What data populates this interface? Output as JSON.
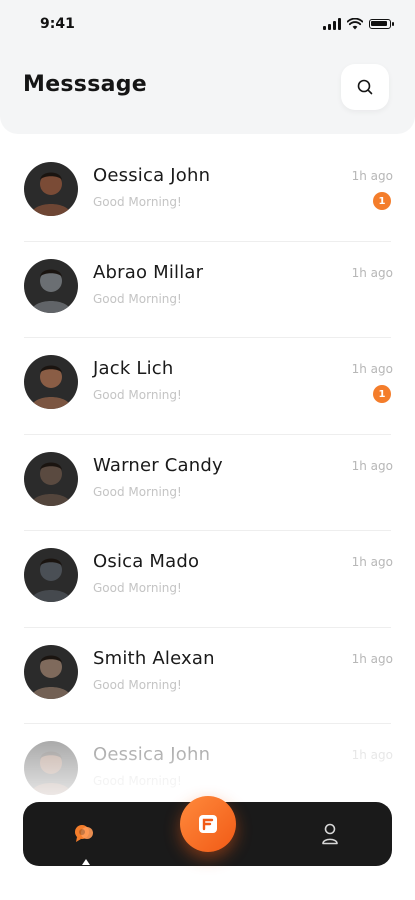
{
  "status": {
    "time": "9:41"
  },
  "header": {
    "title": "Messsage"
  },
  "colors": {
    "accent": "#f47d2b",
    "tabbar": "#1a1a1a",
    "header_bg": "#f4f5f6"
  },
  "icons": {
    "search": "search-icon",
    "chat": "chat-bubble-icon",
    "compose": "compose-icon",
    "profile": "user-icon"
  },
  "conversations": [
    {
      "name": "Oessica John",
      "preview": "Good Morning!",
      "time": "1h ago",
      "badge": "1",
      "avatar_bg": "#7a4b36"
    },
    {
      "name": "Abrao Millar",
      "preview": "Good Morning!",
      "time": "1h ago",
      "badge": null,
      "avatar_bg": "#6b6f73"
    },
    {
      "name": "Jack Lich",
      "preview": "Good Morning!",
      "time": "1h ago",
      "badge": "1",
      "avatar_bg": "#8a5d45"
    },
    {
      "name": "Warner Candy",
      "preview": "Good Morning!",
      "time": "1h ago",
      "badge": null,
      "avatar_bg": "#5a4a40"
    },
    {
      "name": "Osica Mado",
      "preview": "Good Morning!",
      "time": "1h ago",
      "badge": null,
      "avatar_bg": "#4a4f55"
    },
    {
      "name": "Smith Alexan",
      "preview": "Good Morning!",
      "time": "1h ago",
      "badge": null,
      "avatar_bg": "#7f6a5c"
    },
    {
      "name": "Oessica John",
      "preview": "Good Morning!",
      "time": "1h ago",
      "badge": null,
      "avatar_bg": "#7a4b36"
    }
  ]
}
